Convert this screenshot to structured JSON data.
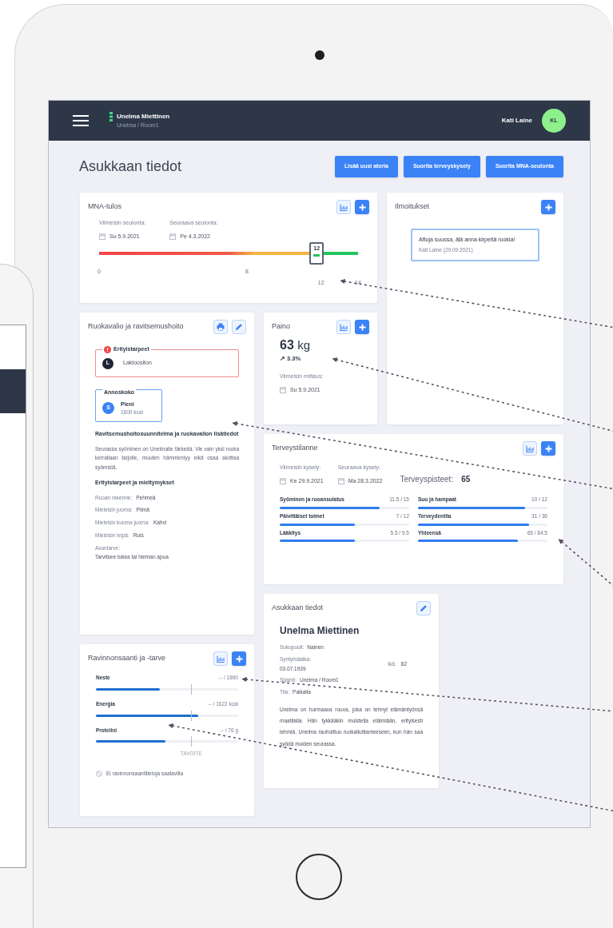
{
  "header": {
    "title": "Unelma Miettinen",
    "subtitle": "Unelma / Room1",
    "user_name": "Kati Laine",
    "user_initials": "KL"
  },
  "page_title": "Asukkaan tiedot",
  "actions": [
    "Lisää uusi ateria",
    "Suorita terveyskysely",
    "Suorita MNA-seulonta"
  ],
  "mna": {
    "title": "MNA-tulos",
    "tools": [
      {
        "kind": "chart"
      },
      {
        "kind": "add"
      }
    ],
    "dates": [
      {
        "label": "Viimeisin seulonta:",
        "value": "Su 5.9.2021"
      },
      {
        "label": "Seuraava seulonta:",
        "value": "Pe 4.3.2022"
      }
    ],
    "score": "12",
    "level": 0.84,
    "ticks": [
      "0",
      "8",
      "12",
      "14"
    ]
  },
  "notifications": {
    "title": "Ilmoitukset",
    "tools": [
      {
        "kind": "add"
      }
    ],
    "items": [
      {
        "text": "Aftoja suussa, älä anna kirpeitä ruokia!",
        "meta": "Kati Laine (29.09.2021)"
      }
    ]
  },
  "diet": {
    "title": "Ruokavalio ja ravitsemushoito",
    "tools": [
      {
        "kind": "print"
      },
      {
        "kind": "edit"
      }
    ],
    "special_needs": {
      "legend": "Erityistarpeet",
      "items": [
        {
          "badge": "L",
          "label": "Laktoositon"
        }
      ]
    },
    "portion": {
      "legend": "Annoskoko",
      "badge": "S",
      "label": "Pieni",
      "sub": "1600 kcal"
    },
    "plan_heading": "Ravitsemushoitosuunnitelma ja ruokavalion lisätiedot",
    "plan_text": "Seurassa syöminen on Unelmalle tärkeää. Vie vain yksi ruoka kerrallaan tarjolle, muuten hämmentyy eikä osaa aloittaa syömistä.",
    "prefs_heading": "Erityistarpeet ja mieltymykset",
    "prefs": [
      {
        "label": "Ruoan rakenne:",
        "value": "Pehmeä"
      },
      {
        "label": "Mieleisin juoma:",
        "value": "Piimä"
      },
      {
        "label": "Mieleisin kuuma juoma:",
        "value": "Kahvi"
      },
      {
        "label": "Mieleisin leipä:",
        "value": "Ruis"
      }
    ],
    "assistance": {
      "label": "Avuntarve:",
      "value": "Tarvitsee tukea tai hieman apua"
    }
  },
  "weight": {
    "title": "Paino",
    "tools": [
      {
        "kind": "chart"
      },
      {
        "kind": "add"
      }
    ],
    "value": "63",
    "unit": "kg",
    "change": "↗ 3.3%",
    "label": "Viimeisin mittaus:",
    "date": "Su 5.9.2021"
  },
  "health": {
    "title": "Terveystilanne",
    "tools": [
      {
        "kind": "chart"
      },
      {
        "kind": "add"
      }
    ],
    "dates": [
      {
        "label": "Viimeisin kysely:",
        "value": "Ke 29.9.2021"
      },
      {
        "label": "Seuraava kysely:",
        "value": "Ma 28.3.2022"
      }
    ],
    "score_label": "Terveyspisteet:",
    "score": "65",
    "metrics": [
      {
        "label": "Syöminen ja ruoansulatus",
        "value": "11.5 / 15",
        "level": 0.77
      },
      {
        "label": "Suu ja hampaat",
        "value": "10 / 12",
        "level": 0.83
      },
      {
        "label": "Päivittäiset toimet",
        "value": "7 / 12",
        "level": 0.58
      },
      {
        "label": "Terveydentila",
        "value": "31 / 36",
        "level": 0.86
      },
      {
        "label": "Lääkitys",
        "value": "5.5 / 9.5",
        "level": 0.58
      },
      {
        "label": "Yhteensä",
        "value": "65 / 84.5",
        "level": 0.77
      }
    ]
  },
  "resident": {
    "title": "Asukkaan tiedot",
    "tools": [
      {
        "kind": "edit"
      }
    ],
    "name": "Unelma Miettinen",
    "fields": [
      {
        "label": "Sukupuoli:",
        "value": "Nainen"
      },
      {
        "label": "Syntymäaika:",
        "value": "03.07.1939"
      },
      {
        "label": "Ikä:",
        "value": "82"
      },
      {
        "label": "Sijainti:",
        "value": "Unelma / Room1"
      },
      {
        "label": "Tila:",
        "value": "Paikalla"
      }
    ],
    "bio": "Unelma on hurmaava rouva, joka on tehnyt elämäntyönsä maatilalla. Hän tykkääkin muistella eläimiään, erityisesti lehmiä. Unelma rauhoittuu ruokailutilanteeseen, kun hän saa syödä muiden seurassa."
  },
  "intake": {
    "title": "Ravinnonsaanti ja -tarve",
    "tools": [
      {
        "kind": "chart"
      },
      {
        "kind": "add"
      }
    ],
    "metrics": [
      {
        "label": "Neste",
        "value": "-- / 1890",
        "level": 0.45
      },
      {
        "label": "Energia",
        "value": "-- / 1622 kcal",
        "level": 0.72
      },
      {
        "label": "Proteiini",
        "value": "-- / 76 g",
        "level": 0.49
      }
    ],
    "target_label": "TAVOITE",
    "note": "Ei ravinnonsaantitietoja saatavilla"
  }
}
